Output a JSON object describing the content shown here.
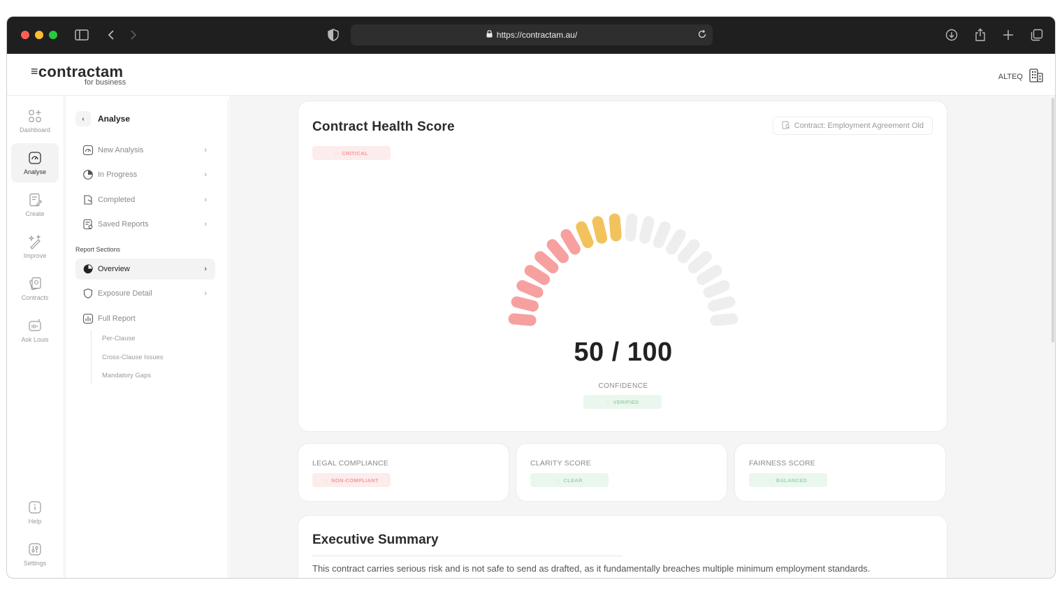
{
  "browser": {
    "url": "https://contractam.au/"
  },
  "header": {
    "logo_main": "contractam",
    "logo_sub": "for business",
    "org_name": "ALTEQ"
  },
  "rail": {
    "items": [
      {
        "label": "Dashboard",
        "icon": "dashboard-icon"
      },
      {
        "label": "Analyse",
        "icon": "analyse-icon"
      },
      {
        "label": "Create",
        "icon": "create-icon"
      },
      {
        "label": "Improve",
        "icon": "improve-icon"
      },
      {
        "label": "Contracts",
        "icon": "contracts-icon"
      },
      {
        "label": "Ask Louis",
        "icon": "ask-louis-icon"
      },
      {
        "label": "Help",
        "icon": "help-icon"
      },
      {
        "label": "Settings",
        "icon": "settings-icon"
      }
    ],
    "active": "Analyse"
  },
  "subnav": {
    "title": "Analyse",
    "items": [
      {
        "label": "New Analysis"
      },
      {
        "label": "In Progress"
      },
      {
        "label": "Completed"
      },
      {
        "label": "Saved Reports"
      }
    ],
    "section_label": "Report Sections",
    "sections": [
      {
        "label": "Overview"
      },
      {
        "label": "Exposure Detail"
      },
      {
        "label": "Full Report"
      }
    ],
    "full_report_children": [
      "Per-Clause",
      "Cross-Clause Issues",
      "Mandatory Gaps"
    ]
  },
  "health": {
    "title": "Contract Health Score",
    "status_badge": "CRITICAL",
    "contract_tag": "Contract: Employment Agreement Old",
    "score_text": "50 / 100",
    "score_value": 50,
    "score_max": 100,
    "confidence_label": "CONFIDENCE",
    "confidence_badge": "VERIFIED",
    "gauge_colors": {
      "low": "#f7a0a0",
      "mid": "#f2c35d",
      "empty": "#eeeeee"
    }
  },
  "metrics": [
    {
      "label": "LEGAL COMPLIANCE",
      "badge": "NON-COMPLIANT"
    },
    {
      "label": "CLARITY SCORE",
      "badge": "CLEAR"
    },
    {
      "label": "FAIRNESS SCORE",
      "badge": "BALANCED"
    }
  ],
  "summary": {
    "title": "Executive Summary",
    "text": "This contract carries serious risk and is not safe to send as drafted, as it fundamentally breaches multiple minimum employment standards."
  }
}
